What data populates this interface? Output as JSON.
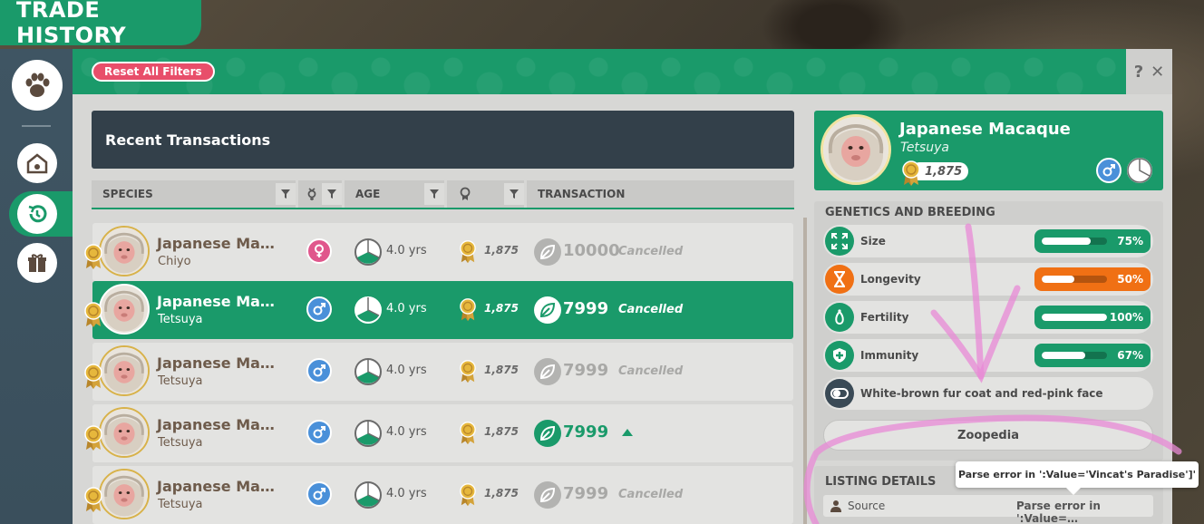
{
  "title": "TRADE HISTORY",
  "toolbar": {
    "reset_filters": "Reset All Filters",
    "help": "?",
    "close": "✕"
  },
  "table": {
    "heading": "Recent Transactions",
    "columns": [
      "SPECIES",
      "AGE",
      "TRANSACTION"
    ],
    "rows": [
      {
        "name": "Japanese Ma…",
        "nickname": "Chiyo",
        "gender": "female",
        "age": "4.0 yrs",
        "price": "1,875",
        "amount": "10000",
        "status": "Cancelled",
        "state": "cancelled"
      },
      {
        "name": "Japanese Ma…",
        "nickname": "Tetsuya",
        "gender": "male",
        "age": "4.0 yrs",
        "price": "1,875",
        "amount": "7999",
        "status": "Cancelled",
        "state": "selected"
      },
      {
        "name": "Japanese Ma…",
        "nickname": "Tetsuya",
        "gender": "male",
        "age": "4.0 yrs",
        "price": "1,875",
        "amount": "7999",
        "status": "Cancelled",
        "state": "cancelled"
      },
      {
        "name": "Japanese Ma…",
        "nickname": "Tetsuya",
        "gender": "male",
        "age": "4.0 yrs",
        "price": "1,875",
        "amount": "7999",
        "status": "",
        "state": "active"
      },
      {
        "name": "Japanese Ma…",
        "nickname": "Tetsuya",
        "gender": "male",
        "age": "4.0 yrs",
        "price": "1,875",
        "amount": "7999",
        "status": "Cancelled",
        "state": "cancelled"
      }
    ]
  },
  "detail": {
    "name": "Japanese Macaque",
    "nickname": "Tetsuya",
    "price": "1,875",
    "genetics_title": "GENETICS AND BREEDING",
    "traits": [
      {
        "label": "Size",
        "pct": "75%",
        "value": 0.75,
        "color": "#1a9a6a",
        "icon": "expand-icon"
      },
      {
        "label": "Longevity",
        "pct": "50%",
        "value": 0.5,
        "color": "#f07014",
        "icon": "hourglass-icon"
      },
      {
        "label": "Fertility",
        "pct": "100%",
        "value": 1.0,
        "color": "#1a9a6a",
        "icon": "fertility-icon"
      },
      {
        "label": "Immunity",
        "pct": "67%",
        "value": 0.67,
        "color": "#1a9a6a",
        "icon": "shield-cross-icon"
      }
    ],
    "description": "White-brown fur coat and red-pink face",
    "zoopedia": "Zoopedia",
    "listing_title": "LISTING DETAILS",
    "source_label": "Source",
    "source_value": "Parse error in ':Value=…",
    "tooltip": "Parse error in ':Value='Vincat's Paradise']'"
  },
  "colors": {
    "accent": "#1a9a6a",
    "male": "#4a90d9",
    "female": "#e0578c",
    "reset": "#e84e6a"
  }
}
